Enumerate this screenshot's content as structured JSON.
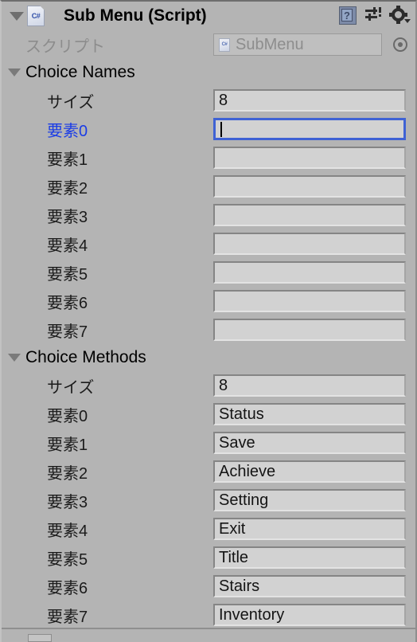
{
  "window": {
    "component_title": "Sub Menu (Script)",
    "component_icon": "csharp-script-icon",
    "background_color": "#b4b4b4",
    "field_color": "#d2d2d2",
    "focus_border_color": "#3f62d4",
    "selected_label_color": "#1a3ce6"
  },
  "header": {
    "foldout_icon": "triangle-down-icon",
    "help_icon": "help-book-icon",
    "preset_icon": "preset-sliders-icon",
    "settings_icon": "gear-dropdown-icon"
  },
  "script_row": {
    "label": "スクリプト",
    "value": "SubMenu",
    "icon": "csharp-script-icon",
    "picker_icon": "circle-select-icon"
  },
  "sections": [
    {
      "title": "Choice Names",
      "foldout_icon": "triangle-down-icon",
      "size_label": "サイズ",
      "size_value": "8",
      "elements": [
        {
          "label": "要素0",
          "value": "",
          "focused": true,
          "selected": true
        },
        {
          "label": "要素1",
          "value": "",
          "focused": false,
          "selected": false
        },
        {
          "label": "要素2",
          "value": "",
          "focused": false,
          "selected": false
        },
        {
          "label": "要素3",
          "value": "",
          "focused": false,
          "selected": false
        },
        {
          "label": "要素4",
          "value": "",
          "focused": false,
          "selected": false
        },
        {
          "label": "要素5",
          "value": "",
          "focused": false,
          "selected": false
        },
        {
          "label": "要素6",
          "value": "",
          "focused": false,
          "selected": false
        },
        {
          "label": "要素7",
          "value": "",
          "focused": false,
          "selected": false
        }
      ]
    },
    {
      "title": "Choice Methods",
      "foldout_icon": "triangle-down-icon",
      "size_label": "サイズ",
      "size_value": "8",
      "elements": [
        {
          "label": "要素0",
          "value": "Status",
          "focused": false,
          "selected": false
        },
        {
          "label": "要素1",
          "value": "Save",
          "focused": false,
          "selected": false
        },
        {
          "label": "要素2",
          "value": "Achieve",
          "focused": false,
          "selected": false
        },
        {
          "label": "要素3",
          "value": "Setting",
          "focused": false,
          "selected": false
        },
        {
          "label": "要素4",
          "value": "Exit",
          "focused": false,
          "selected": false
        },
        {
          "label": "要素5",
          "value": "Title",
          "focused": false,
          "selected": false
        },
        {
          "label": "要素6",
          "value": "Stairs",
          "focused": false,
          "selected": false
        },
        {
          "label": "要素7",
          "value": "Inventory",
          "focused": false,
          "selected": false
        }
      ]
    }
  ]
}
